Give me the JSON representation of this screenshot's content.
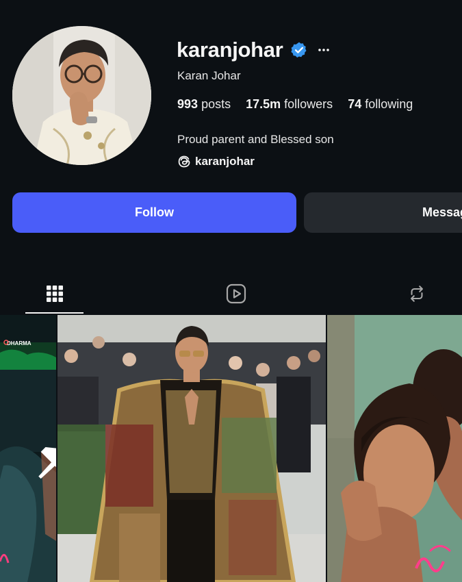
{
  "profile": {
    "username": "karanjohar",
    "full_name": "Karan Johar",
    "bio": "Proud parent and Blessed son",
    "threads_handle": "karanjohar",
    "verified": true,
    "stats": {
      "posts_count": "993",
      "posts_label": "posts",
      "followers_count": "17.5m",
      "followers_label": "followers",
      "following_count": "74",
      "following_label": "following"
    }
  },
  "actions": {
    "follow_label": "Follow",
    "message_label": "Message"
  },
  "tabs": [
    {
      "name": "posts",
      "icon": "grid-icon",
      "active": true
    },
    {
      "name": "reels",
      "icon": "reels-icon",
      "active": false
    },
    {
      "name": "reposts",
      "icon": "repost-icon",
      "active": false
    }
  ],
  "grid": {
    "posts": [
      {
        "icon": "pin-icon",
        "pinned": true,
        "overlay_text": "DHARMA"
      },
      {
        "icon": "pin-icon",
        "pinned": true
      },
      {
        "pinned": false
      }
    ]
  },
  "colors": {
    "background": "#0c1014",
    "accent": "#4a5df9",
    "secondary_button": "#25292e",
    "verified": "#3897f0"
  }
}
